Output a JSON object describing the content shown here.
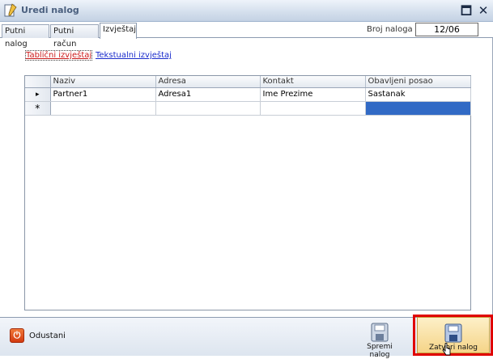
{
  "window": {
    "title": "Uredi nalog",
    "maximize_glyph": "🗖",
    "close_glyph": "✕"
  },
  "tabs": [
    {
      "label": "Putni nalog"
    },
    {
      "label": "Putni račun"
    },
    {
      "label": "Izvještaj",
      "active": true
    }
  ],
  "order_count": {
    "label": "Broj naloga :",
    "value": "12/06"
  },
  "report_links": {
    "table": "Tablični izvještaj",
    "text": "Tekstualni izvještaj"
  },
  "grid": {
    "columns": [
      "Naziv",
      "Adresa",
      "Kontakt",
      "Obavljeni posao"
    ],
    "rows": [
      {
        "marker": "▸",
        "cells": [
          "Partner1",
          "Adresa1",
          "Ime Prezime",
          "Sastanak"
        ]
      },
      {
        "marker": "*",
        "cells": [
          "",
          "",
          "",
          ""
        ]
      }
    ]
  },
  "footer": {
    "cancel_label": "Odustani",
    "save_label": "Spremi nalog",
    "close_label": "Zatvori nalog"
  },
  "colors": {
    "highlight": "#e00000",
    "selection": "#316ac5",
    "link_active": "#cc1a1a",
    "link": "#1a2ccc"
  }
}
